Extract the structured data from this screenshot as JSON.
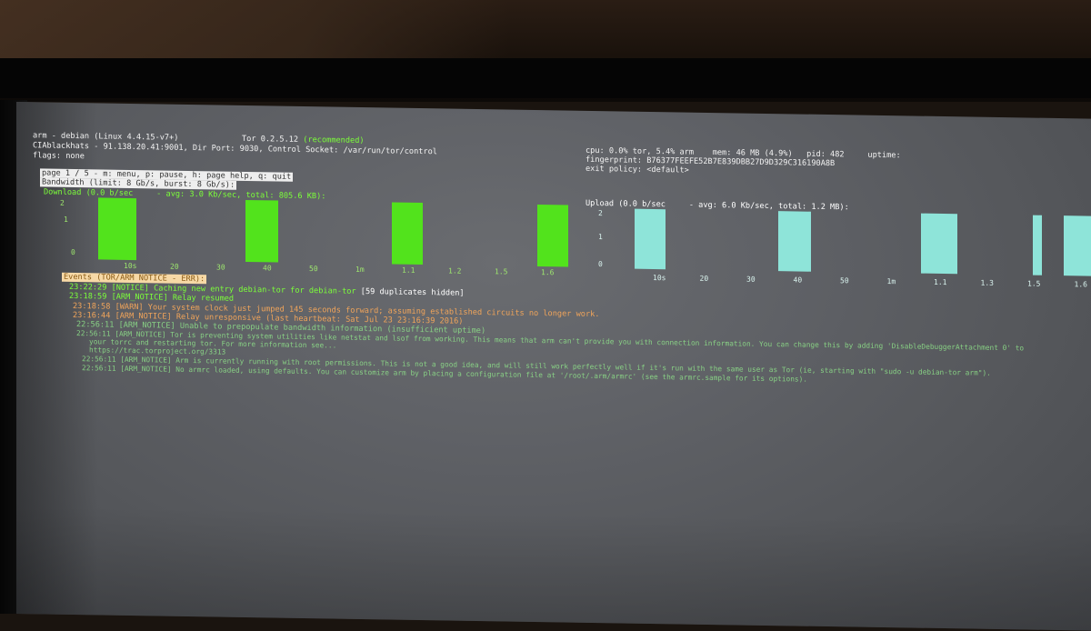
{
  "header": {
    "system": "arm - debian (Linux 4.4.15-v7+)",
    "tor_version": "Tor 0.2.5.12",
    "tor_version_status": "(recommended)",
    "relay": "CIAblackhats - 91.138.20.41:9001, Dir Port: 9030, Control Socket: /var/run/tor/control",
    "flags": "flags: none",
    "stats": "cpu: 0.0% tor, 5.4% arm    mem: 46 MB (4.9%)   pid: 482     uptime:",
    "fingerprint": "fingerprint: B76377FEEFE52B7E839DBB27D9D329C316190A8B",
    "exit_policy": "exit policy: <default>"
  },
  "page_line": "page 1 / 5 - m: menu, p: pause, h: page help, q: quit",
  "bandwidth_label": "Bandwidth (limit: 8 Gb/s, burst: 8 Gb/s):",
  "download": {
    "title": "Download (0.0 b/sec     - avg: 3.0 Kb/sec, total: 805.6 KB):",
    "y_labels": [
      "2",
      "1",
      "0"
    ],
    "x_labels": [
      "10s",
      "20",
      "30",
      "40",
      "50",
      "1m",
      "1.1",
      "1.2",
      "1.5",
      "1.6"
    ],
    "bar_levels": [
      2,
      2,
      2,
      2
    ]
  },
  "upload": {
    "title": "Upload (0.0 b/sec     - avg: 6.0 Kb/sec, total: 1.2 MB):",
    "y_labels": [
      "2",
      "1",
      "0"
    ],
    "x_labels": [
      "10s",
      "20",
      "30",
      "40",
      "50",
      "1m",
      "1.1",
      "1.3",
      "1.5",
      "1.6"
    ],
    "bar_levels": [
      2,
      2,
      2,
      2,
      2
    ]
  },
  "events": {
    "header": "Events (TOR/ARM NOTICE - ERR):",
    "lines": [
      {
        "text": "23:22:29 [NOTICE] Caching new entry debian-tor for debian-tor",
        "suffix": " [59 duplicates hidden]"
      },
      {
        "text": "23:18:59 [ARM_NOTICE] Relay resumed"
      },
      {
        "text": "23:18:58 [WARN] Your system clock just jumped 145 seconds forward; assuming established circuits no longer work."
      },
      {
        "text": "23:16:44 [ARM_NOTICE] Relay unresponsive (last heartbeat: Sat Jul 23 23:16:39 2016)"
      },
      {
        "text": "22:56:11 [ARM_NOTICE] Unable to prepopulate bandwidth information (insufficient uptime)"
      },
      {
        "text": "22:56:11 [ARM_NOTICE] Tor is preventing system utilities like netstat and lsof from working. This means that arm can't provide you with connection information. You can change this by adding 'DisableDebuggerAttachment 0' to"
      },
      {
        "text": "your torrc and restarting tor. For more information see..."
      },
      {
        "text": "https://trac.torproject.org/3313"
      },
      {
        "text": "22:56:11 [ARM_NOTICE] Arm is currently running with root permissions. This is not a good idea, and will still work perfectly well if it's run with the same user as Tor (ie, starting with \"sudo -u debian-tor arm\")."
      },
      {
        "text": "22:56:11 [ARM_NOTICE] No armrc loaded, using defaults. You can customize arm by placing a configuration file at '/root/.arm/armrc' (see the armrc.sample for its options)."
      }
    ]
  },
  "colors": {
    "terminal_text": "#f2f2f2",
    "download_bar": "#52e31c",
    "upload_bar": "#8ee4d9",
    "notice_green": "#7cff3a",
    "warn_orange": "#f0a45a"
  }
}
